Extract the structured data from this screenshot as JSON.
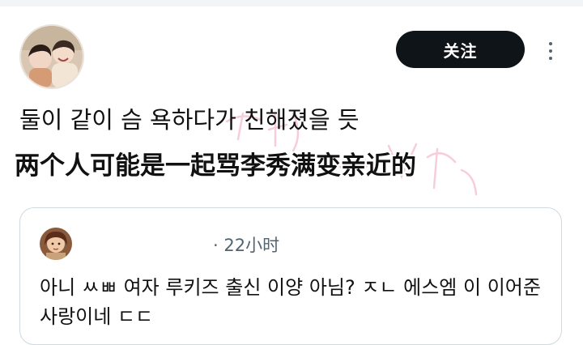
{
  "header": {
    "follow_label": "关注",
    "more_icon": "more-dots-icon"
  },
  "post": {
    "korean_text": "둘이 같이 슴 욕하다가 친해졌을 듯",
    "translation_text": "两个人可能是一起骂李秀满变亲近的"
  },
  "reply": {
    "time": "· 22小时",
    "text": "아니 ㅆㅃ 여자 루키즈 출신 이양 아님? ㅈㄴ 에스엠 이 이어준 사랑이네 ㄷㄷ"
  },
  "colors": {
    "follow_button_bg": "#0f1419",
    "follow_button_text": "#ffffff",
    "secondary_text": "#536471",
    "card_border": "#cfd9de",
    "watermark": "#f4a6bd"
  }
}
